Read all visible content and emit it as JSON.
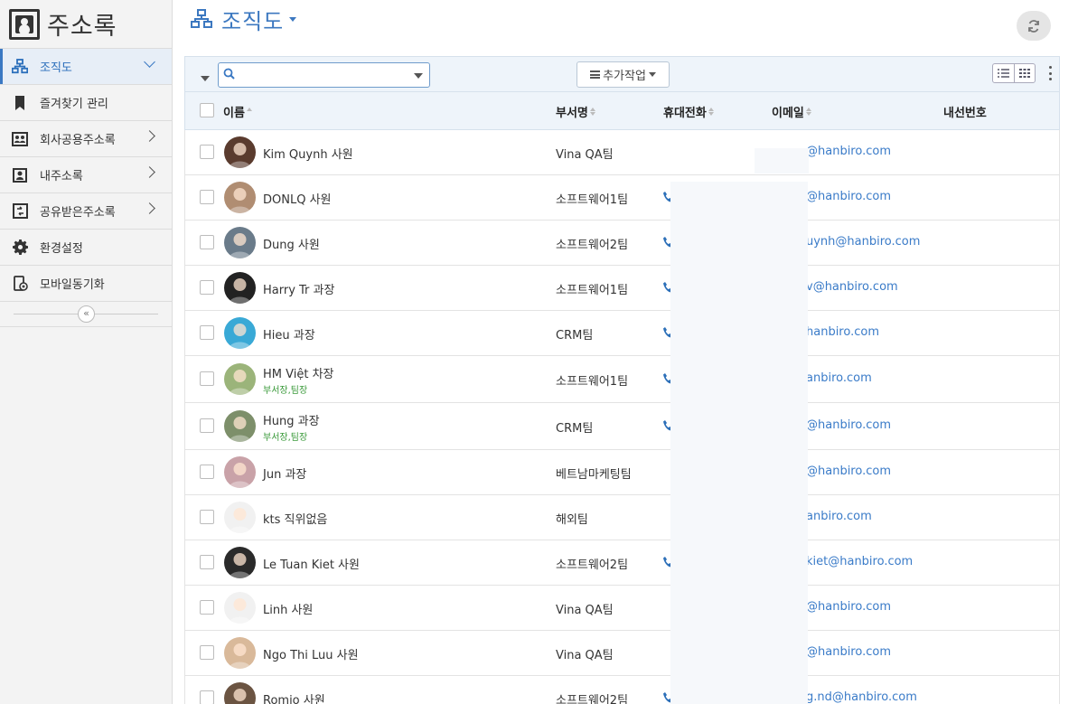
{
  "app": {
    "title": "주소록"
  },
  "sidebar": {
    "items": [
      {
        "label": "조직도",
        "icon": "org-chart-icon",
        "active": true,
        "chevron": true
      },
      {
        "label": "즐겨찾기 관리",
        "icon": "bookmark-icon",
        "active": false,
        "chevron": false
      },
      {
        "label": "회사공용주소록",
        "icon": "company-book-icon",
        "active": false,
        "chevron": true
      },
      {
        "label": "내주소록",
        "icon": "contact-book-icon",
        "active": false,
        "chevron": true
      },
      {
        "label": "공유받은주소록",
        "icon": "shared-book-icon",
        "active": false,
        "chevron": true
      },
      {
        "label": "환경설정",
        "icon": "gear-icon",
        "active": false,
        "chevron": false
      },
      {
        "label": "모바일동기화",
        "icon": "mobile-sync-icon",
        "active": false,
        "chevron": false
      }
    ],
    "collapse_glyph": "«"
  },
  "header": {
    "title": "조직도"
  },
  "toolbar": {
    "search": {
      "value": "",
      "placeholder": ""
    },
    "extra_label": "추가작업"
  },
  "table": {
    "columns": {
      "name": "이름",
      "dept": "부서명",
      "phone": "휴대전화",
      "email": "이메일",
      "ext": "내선번호"
    },
    "rows": [
      {
        "name": "Kim Quynh 사원",
        "role": "",
        "dept": "Vina QA팀",
        "phone": false,
        "email": "@hanbiro.com",
        "avatar": "#5a3b2e"
      },
      {
        "name": "DONLQ 사원",
        "role": "",
        "dept": "소프트웨어1팀",
        "phone": true,
        "email": "@hanbiro.com",
        "avatar": "#b08d72"
      },
      {
        "name": "Dung 사원",
        "role": "",
        "dept": "소프트웨어2팀",
        "phone": true,
        "email": "uynh@hanbiro.com",
        "avatar": "#6a7b8a"
      },
      {
        "name": "Harry Tr 과장",
        "role": "",
        "dept": "소프트웨어1팀",
        "phone": true,
        "email": "v@hanbiro.com",
        "avatar": "#222222"
      },
      {
        "name": "Hieu 과장",
        "role": "",
        "dept": "CRM팀",
        "phone": true,
        "email": "hanbiro.com",
        "avatar": "#39a9d6"
      },
      {
        "name": "HM Việt 차장",
        "role": "부서장,팀장",
        "dept": "소프트웨어1팀",
        "phone": true,
        "email": "anbiro.com",
        "avatar": "#9bb47a"
      },
      {
        "name": "Hung 과장",
        "role": "부서장,팀장",
        "dept": "CRM팀",
        "phone": true,
        "email": "@hanbiro.com",
        "avatar": "#7d8f6a"
      },
      {
        "name": "Jun 과장",
        "role": "",
        "dept": "베트남마케팅팀",
        "phone": false,
        "email": "@hanbiro.com",
        "avatar": "#c9a2a8"
      },
      {
        "name": "kts 직위없음",
        "role": "",
        "dept": "해외팀",
        "phone": false,
        "email": "anbiro.com",
        "avatar": "#f1f1f1"
      },
      {
        "name": "Le Tuan Kiet 사원",
        "role": "",
        "dept": "소프트웨어2팀",
        "phone": true,
        "email": "kiet@hanbiro.com",
        "avatar": "#2a2a2a"
      },
      {
        "name": "Linh 사원",
        "role": "",
        "dept": "Vina QA팀",
        "phone": false,
        "email": "@hanbiro.com",
        "avatar": "#f1f1f1"
      },
      {
        "name": "Ngo Thi Luu 사원",
        "role": "",
        "dept": "Vina QA팀",
        "phone": false,
        "email": "@hanbiro.com",
        "avatar": "#d9b99a"
      },
      {
        "name": "Romio 사원",
        "role": "",
        "dept": "소프트웨어2팀",
        "phone": true,
        "email": "g.nd@hanbiro.com",
        "avatar": "#6b5442"
      }
    ]
  },
  "colors": {
    "accent": "#3c78c0",
    "link": "#3a7bc8",
    "role": "#3a9a3a"
  }
}
